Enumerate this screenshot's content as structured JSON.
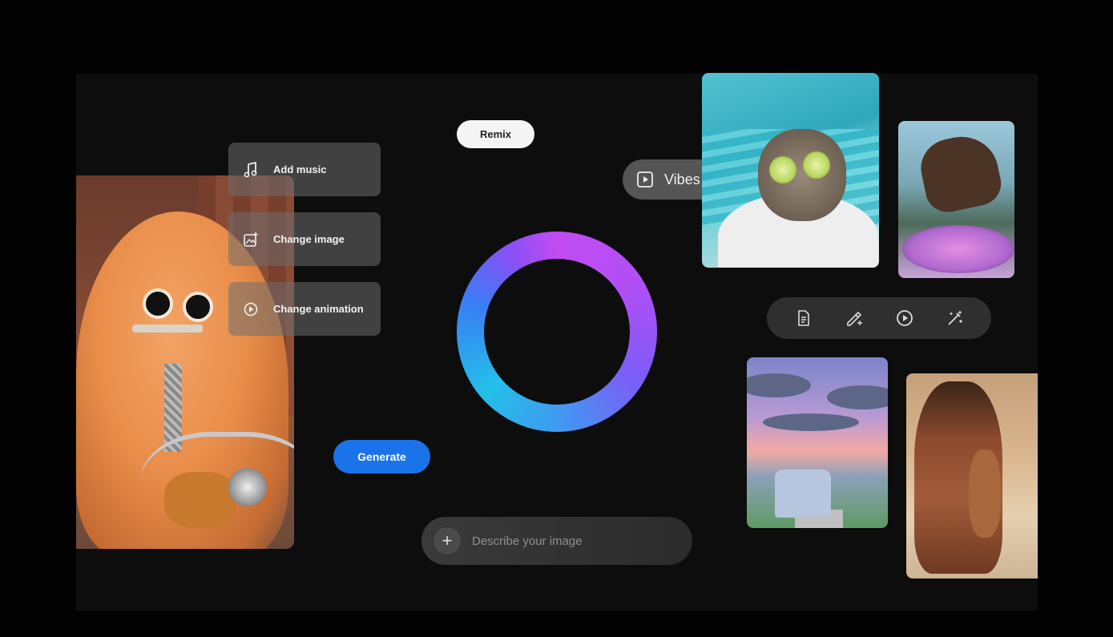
{
  "menu": {
    "items": [
      {
        "label": "Add music",
        "icon": "music-note-icon"
      },
      {
        "label": "Change image",
        "icon": "image-edit-icon"
      },
      {
        "label": "Change animation",
        "icon": "play-circle-icon"
      }
    ]
  },
  "remix": {
    "label": "Remix"
  },
  "generate": {
    "label": "Generate"
  },
  "prompt": {
    "placeholder": "Describe your image",
    "add_icon": "plus-icon"
  },
  "vibes": {
    "label": "Vibes",
    "icon": "video-play-icon"
  },
  "toolbar": {
    "icons": [
      "document-icon",
      "pencil-sparkle-icon",
      "play-circle-icon",
      "magic-wand-icon"
    ]
  },
  "colors": {
    "background": "#0d0d0d",
    "generate_blue": "#1a73e8",
    "ring_purple": "#c14cf2",
    "ring_blue": "#23c0e8",
    "menu_card": "#6e6e6e"
  }
}
